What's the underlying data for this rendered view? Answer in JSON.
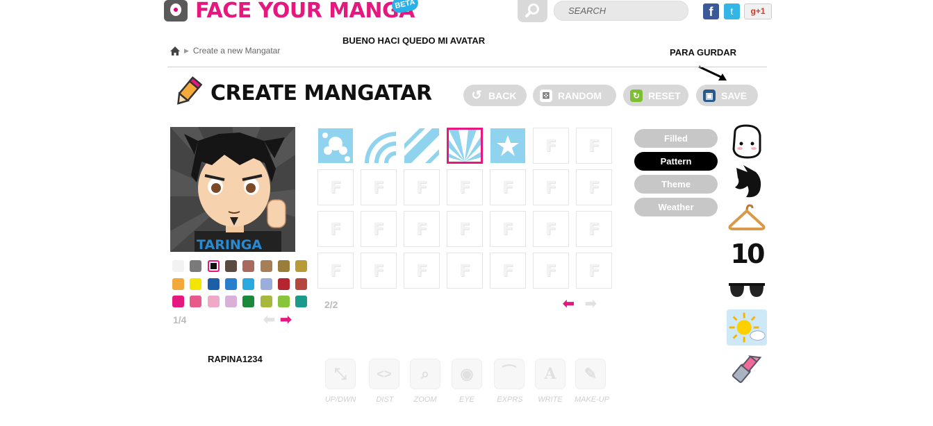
{
  "header": {
    "logo_text": "FACE YOUR MANGA",
    "beta_label": "BETA",
    "search_placeholder": "Search",
    "facebook_label": "f",
    "twitter_label": "t",
    "gplus_label": "g+1"
  },
  "annotations": {
    "note_avatar": "BUENO HACI QUEDO MI AVATAR",
    "note_save": "PARA GURDAR"
  },
  "breadcrumb": {
    "current": "Create a new Mangatar"
  },
  "page": {
    "title": "CREATE MANGATAR"
  },
  "actions": {
    "back": "BACK",
    "random": "RANDOM",
    "reset": "RESET",
    "save": "SAVE"
  },
  "avatar": {
    "shirt_text": "TARINGA",
    "palette_page": "1/4",
    "username": "RAPINA1234"
  },
  "palette": {
    "colors": [
      "#f2f2f2",
      "#7a7a7a",
      "#111111",
      "#5a4a40",
      "#a86a5c",
      "#a87e54",
      "#9a7d3a",
      "#b89a36",
      "#f2a93a",
      "#f2e600",
      "#1a5fa8",
      "#2a7fcc",
      "#2aa9e0",
      "#9aaede",
      "#b5242f",
      "#b4463e",
      "#e4187e",
      "#e85a8a",
      "#f0a8c8",
      "#d8b0d8",
      "#1a8a3a",
      "#a8b83a",
      "#8ac43a",
      "#1a9a8a"
    ],
    "selected_index": 2
  },
  "grid": {
    "page": "2/2",
    "placeholder_letter": "F",
    "selected_index": 3
  },
  "categories": {
    "items": [
      "Filled",
      "Pattern",
      "Theme",
      "Weather"
    ],
    "active": "Pattern"
  },
  "side_icons": {
    "number_label": "10"
  },
  "tools": {
    "items": [
      "UP/DWN",
      "DIST",
      "ZOOM",
      "EYE",
      "EXPRS",
      "WRITE",
      "MAKE-UP"
    ]
  },
  "colors": {
    "brand_pink": "#e4187e",
    "pattern_blue": "#8fd3ef",
    "button_gray": "#d8d8d8"
  }
}
